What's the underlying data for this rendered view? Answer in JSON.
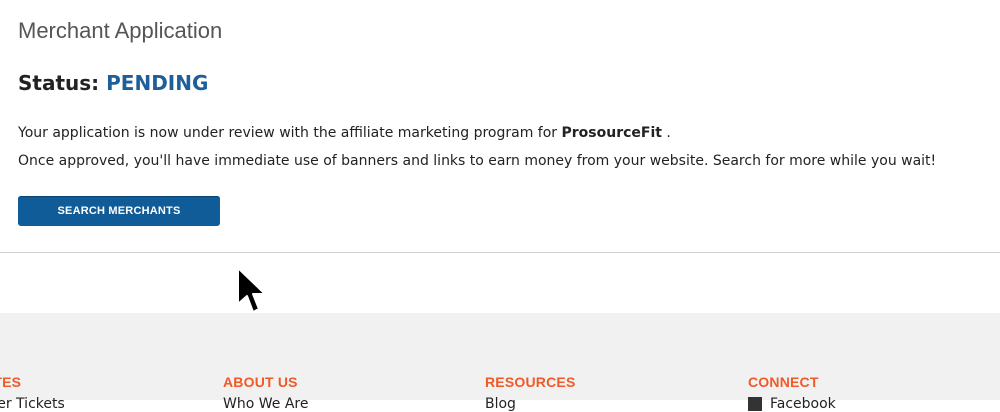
{
  "page": {
    "title": "Merchant Application",
    "status_label": "Status:",
    "status_value": "PENDING",
    "message_line1_prefix": "Your application is now under review with the affiliate marketing program for",
    "merchant_name": "ProsourceFit",
    "message_line1_suffix": ".",
    "message_line2": "Once approved, you'll have immediate use of banners and links to earn money from your website. Search for more while you wait!",
    "button_label": "SEARCH MERCHANTS"
  },
  "footer": {
    "columns": [
      {
        "heading": "IATES",
        "items": [
          "...ler Tickets"
        ]
      },
      {
        "heading": "ABOUT US",
        "items": [
          "Who We Are"
        ]
      },
      {
        "heading": "RESOURCES",
        "items": [
          "Blog"
        ]
      },
      {
        "heading": "CONNECT",
        "items": [
          "Facebook"
        ]
      }
    ]
  },
  "colors": {
    "status_value": "#1f5f99",
    "button_bg": "#0f5c99",
    "footer_heading": "#f05a28",
    "footer_bg": "#f1f1f1"
  },
  "icons": {
    "cursor": "arrow-cursor-icon",
    "facebook": "facebook-icon"
  }
}
